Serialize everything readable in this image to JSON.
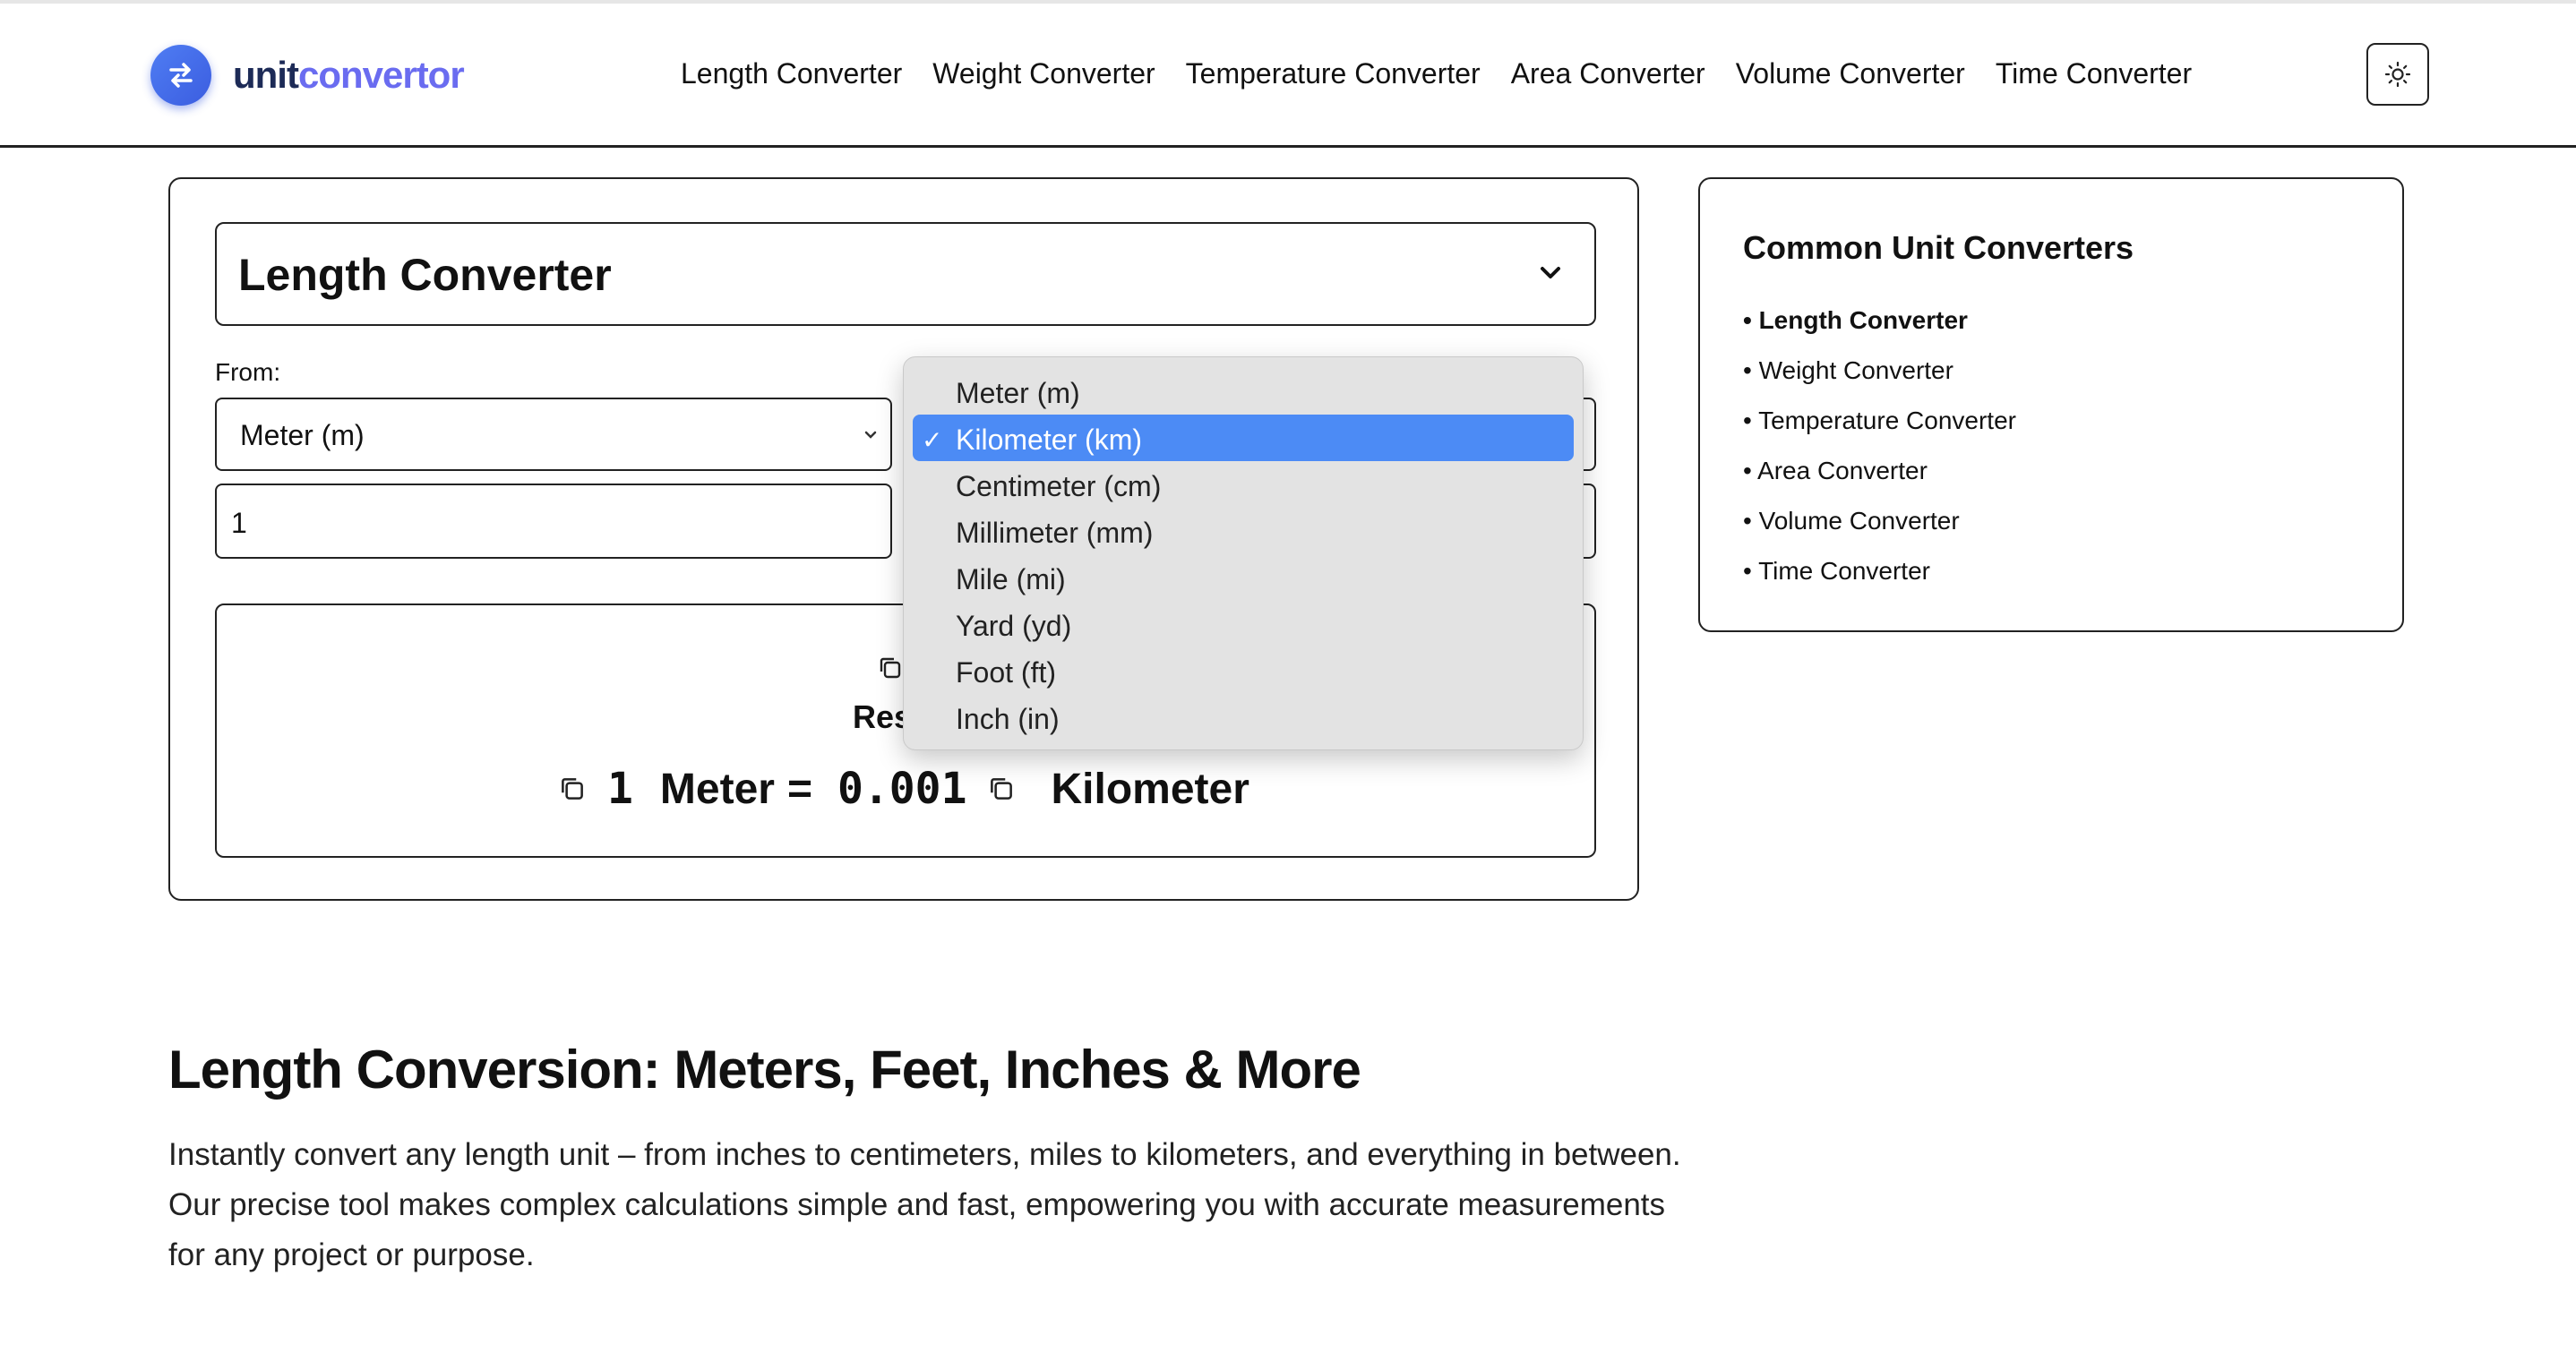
{
  "brand": {
    "part1": "unit",
    "part2": "convertor"
  },
  "nav": [
    {
      "label": "Length Converter"
    },
    {
      "label": "Weight Converter"
    },
    {
      "label": "Temperature Converter"
    },
    {
      "label": "Area Converter"
    },
    {
      "label": "Volume Converter"
    },
    {
      "label": "Time Converter"
    }
  ],
  "converter": {
    "type_selected": "Length Converter",
    "from_label": "From:",
    "from_unit": "Meter (m)",
    "from_value": "1",
    "result_title": "Result",
    "result_title_visible": "Res",
    "result": {
      "from_value": "1",
      "from_unit": "Meter",
      "equals": "=",
      "to_value": "0.001",
      "to_unit": "Kilometer"
    }
  },
  "dropdown": {
    "selected": "Kilometer (km)",
    "check": "✓",
    "options": [
      {
        "label": "Meter (m)"
      },
      {
        "label": "Kilometer (km)"
      },
      {
        "label": "Centimeter (cm)"
      },
      {
        "label": "Millimeter (mm)"
      },
      {
        "label": "Mile (mi)"
      },
      {
        "label": "Yard (yd)"
      },
      {
        "label": "Foot (ft)"
      },
      {
        "label": "Inch (in)"
      }
    ]
  },
  "sidebar": {
    "title": "Common Unit Converters",
    "items": [
      {
        "label": "• Length Converter",
        "active": true
      },
      {
        "label": "• Weight Converter"
      },
      {
        "label": "• Temperature Converter"
      },
      {
        "label": "• Area Converter"
      },
      {
        "label": "• Volume Converter"
      },
      {
        "label": "• Time Converter"
      }
    ]
  },
  "article": {
    "title": "Length Conversion: Meters, Feet, Inches & More",
    "description": "Instantly convert any length unit – from inches to centimeters, miles to kilometers, and everything in between. Our precise tool makes complex calculations simple and fast, empowering you with accurate measurements for any project or purpose."
  },
  "colors": {
    "accent": "#4c8bf5",
    "brand_dark": "#1d2b57",
    "brand_light": "#6a6cf0"
  }
}
